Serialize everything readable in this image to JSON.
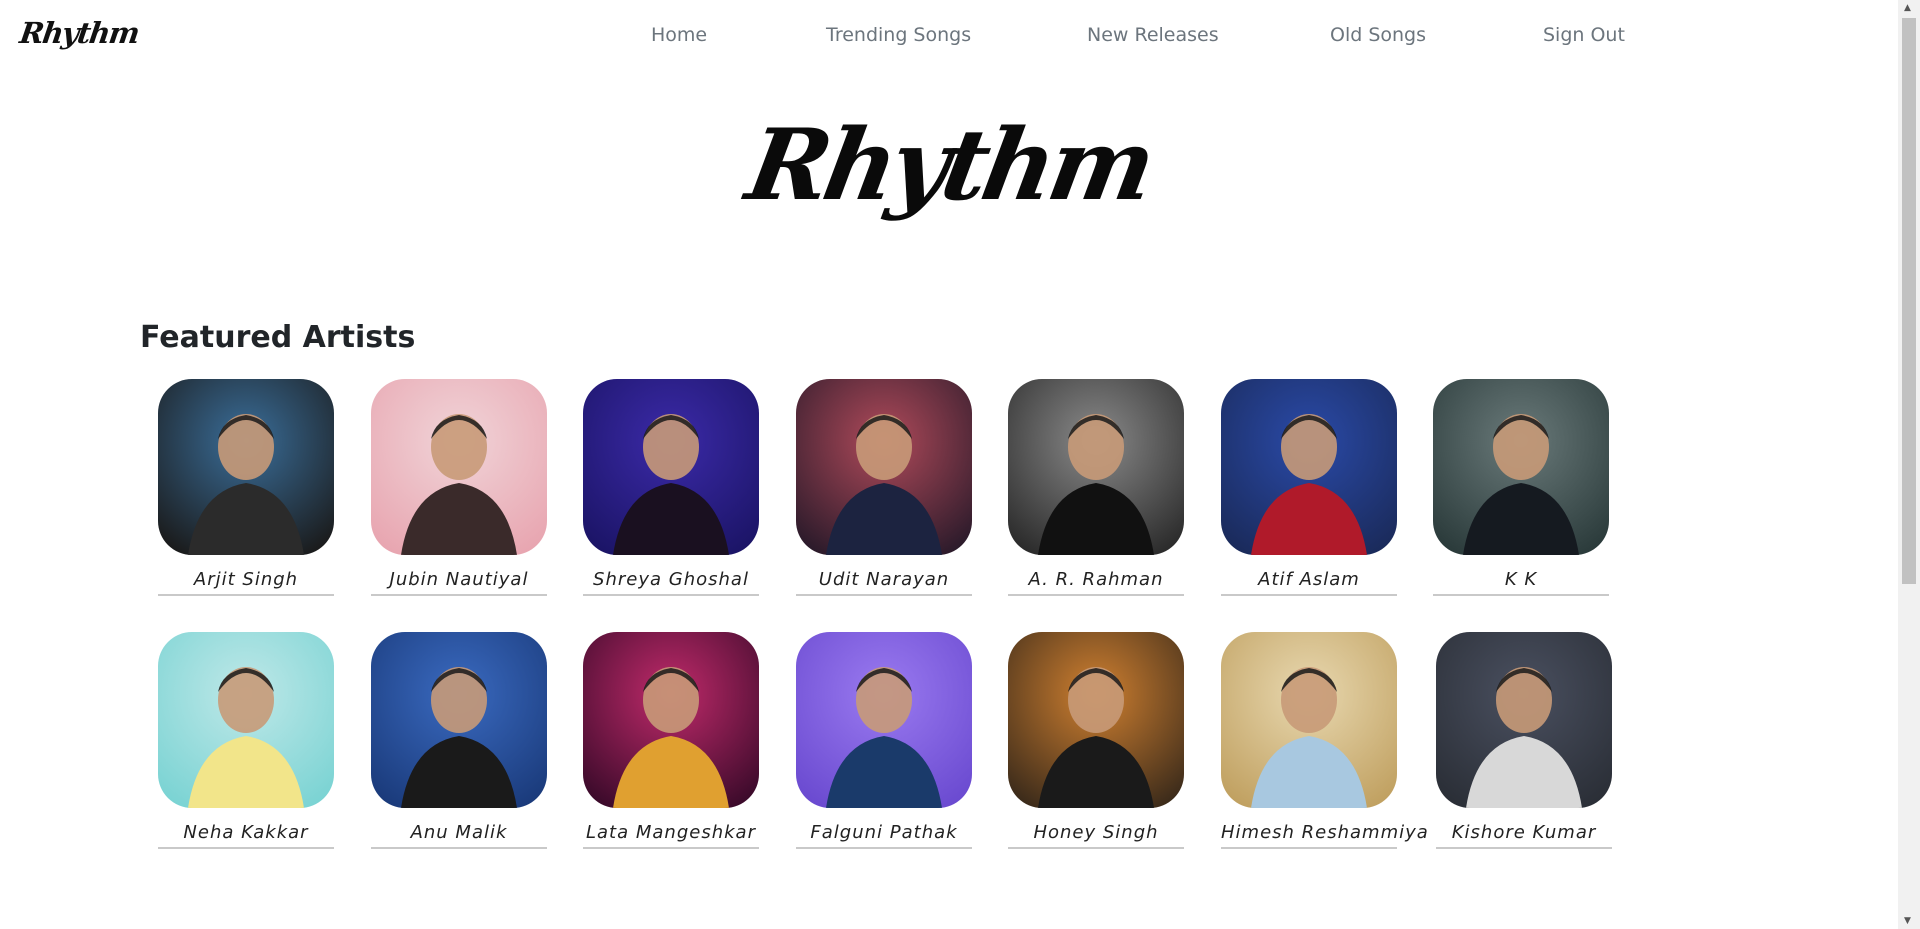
{
  "brand": "Rhythm",
  "nav": {
    "home": "Home",
    "trending": "Trending Songs",
    "new_releases": "New Releases",
    "old_songs": "Old Songs",
    "sign_out": "Sign Out"
  },
  "hero_title": "Rhythm",
  "section_title": "Featured Artists",
  "artists": [
    {
      "name": "Arjit Singh",
      "colors": [
        "#1a1a1a",
        "#3a6e9a",
        "#2b2b2b"
      ]
    },
    {
      "name": "Jubin Nautiyal",
      "colors": [
        "#e8a5b0",
        "#f0d4d8",
        "#3a2a2a"
      ]
    },
    {
      "name": "Shreya Ghoshal",
      "colors": [
        "#1b1466",
        "#3b2aa8",
        "#1a1020"
      ]
    },
    {
      "name": "Udit Narayan",
      "colors": [
        "#2a1a2a",
        "#b04a5a",
        "#1c2340"
      ]
    },
    {
      "name": "A. R. Rahman",
      "colors": [
        "#2a2a2a",
        "#8a8a8a",
        "#111111"
      ]
    },
    {
      "name": "Atif Aslam",
      "colors": [
        "#1a2a5a",
        "#2a4aa8",
        "#b01a2a"
      ]
    },
    {
      "name": "K K",
      "colors": [
        "#2a3a3a",
        "#6a7a7a",
        "#151a20"
      ]
    },
    {
      "name": "Neha Kakkar",
      "colors": [
        "#7ad3d3",
        "#bfe8e8",
        "#f2e58a"
      ]
    },
    {
      "name": "Anu Malik",
      "colors": [
        "#1a3a7a",
        "#3a6ac0",
        "#1a1a1a"
      ]
    },
    {
      "name": "Lata Mangeshkar",
      "colors": [
        "#3a0a2a",
        "#c02a6a",
        "#e0a030"
      ]
    },
    {
      "name": "Falguni Pathak",
      "colors": [
        "#6a4ad0",
        "#9a7af0",
        "#1a3a6a"
      ]
    },
    {
      "name": "Honey Singh",
      "colors": [
        "#3a2a1a",
        "#d08030",
        "#1a1a1a"
      ]
    },
    {
      "name": "Himesh Reshammiya",
      "colors": [
        "#c0a060",
        "#e8d8b0",
        "#a8c8e0"
      ]
    },
    {
      "name": "Kishore Kumar",
      "colors": [
        "#2a2e36",
        "#4a5060",
        "#d8d8d8"
      ]
    }
  ]
}
